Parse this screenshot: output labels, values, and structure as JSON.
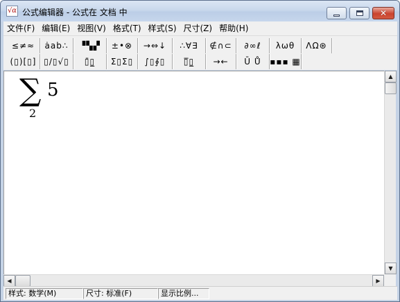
{
  "window": {
    "title": "公式编辑器 - 公式在 文档 中",
    "icon": "formula-editor-icon",
    "icon_glyph": "√α",
    "controls": {
      "minimize": "minimize-icon",
      "maximize": "maximize-icon",
      "close": "✕"
    }
  },
  "menu": {
    "items": [
      "文件(F)",
      "编辑(E)",
      "视图(V)",
      "格式(T)",
      "样式(S)",
      "尺寸(Z)",
      "帮助(H)"
    ]
  },
  "toolbar": {
    "row1": [
      "≤≠≈",
      "ȧab∴",
      "▝▚▞",
      "±•⊗",
      "→⇔↓",
      "∴∀∃",
      "∉∩⊂",
      "∂∞ℓ",
      "λωθ",
      "ΛΩ⊛"
    ],
    "row2": [
      "(▯)[▯]",
      "▯/▯√▯",
      "▯̄▯̲",
      "Σ▯Σ▯",
      "∫▯∮▯",
      "▯̅▯̲",
      "→←",
      "Ū Ů",
      "▪▪▪ ▦"
    ]
  },
  "formula": {
    "operator": "∑",
    "argument": "5",
    "lower_limit": "2"
  },
  "statusbar": {
    "style": "样式: 数学(M)",
    "size": "尺寸: 标准(F)",
    "zoom": "显示比例..."
  },
  "colors": {
    "titlebar": "#c9d8ec",
    "close_button": "#c9432f",
    "toolbar": "#f0f0f0",
    "editor": "#ffffff"
  }
}
